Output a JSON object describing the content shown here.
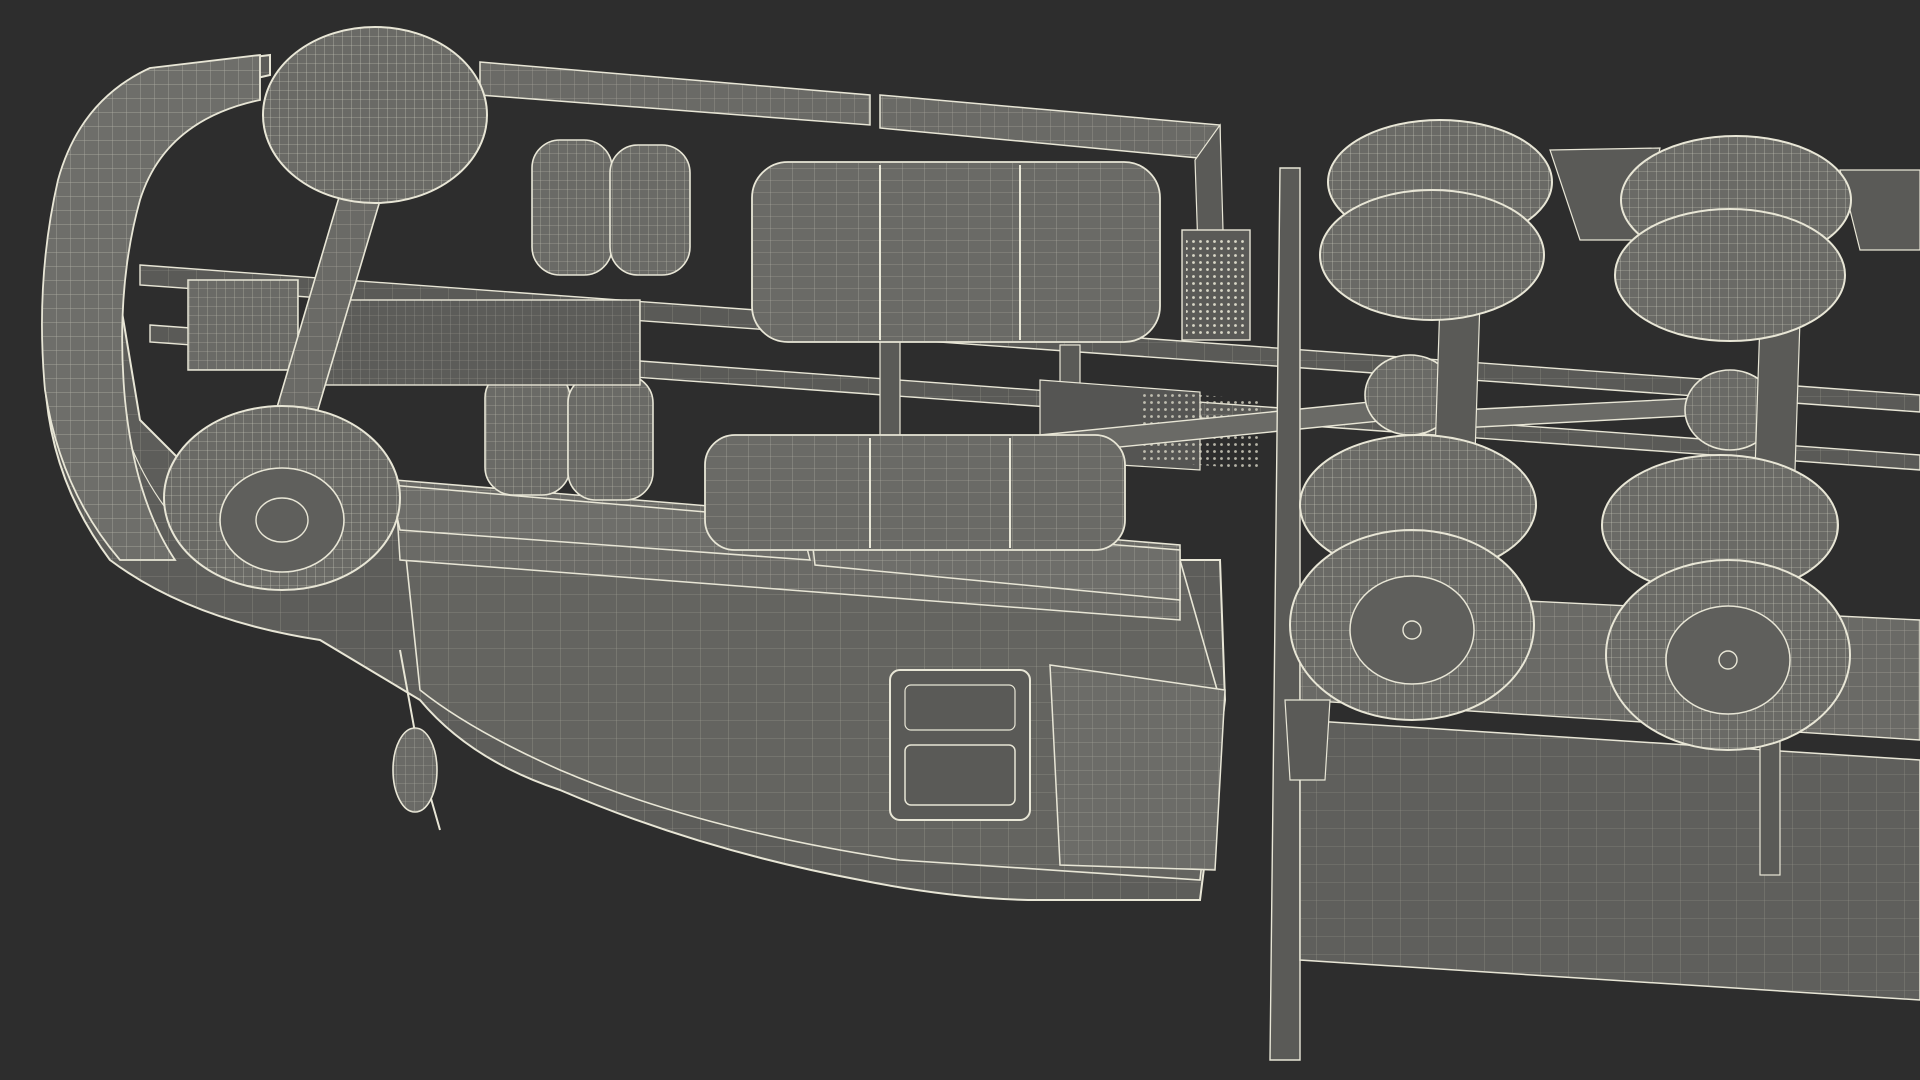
{
  "scene": {
    "subject": "truck-chassis-underside-wireframe",
    "palette": {
      "background": "#2d2d2d",
      "body_fill": "#5f5f5c",
      "body_fill_dark": "#4a4a48",
      "body_fill_light": "#6c6c68",
      "wire": "#e8e6d6",
      "wire_dim": "#bdbbad",
      "tire_fill": "#6a6a66",
      "frame_fill": "#555553"
    }
  }
}
